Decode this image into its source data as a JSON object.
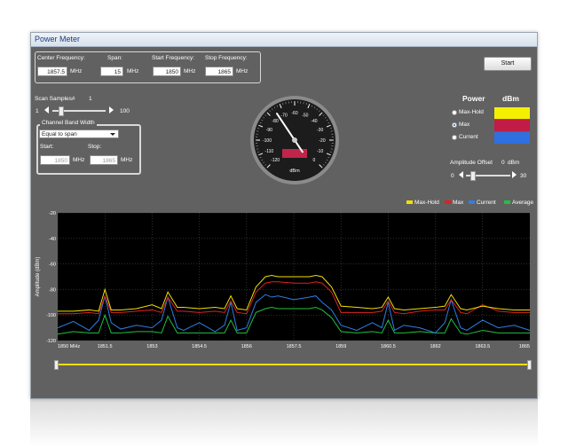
{
  "window": {
    "title": "Power Meter"
  },
  "frequency": {
    "center_label": "Center Frequency:",
    "center_value": "1857.5",
    "center_unit": "MHz",
    "span_label": "Span:",
    "span_value": "15",
    "span_unit": "MHz",
    "start_label": "Start Frequency:",
    "start_value": "1850",
    "start_unit": "MHz",
    "stop_label": "Stop Frequency:",
    "stop_value": "1865",
    "stop_unit": "MHz"
  },
  "start_button": "Start",
  "scan": {
    "label": "Scan Samples#",
    "value": "1",
    "min": "1",
    "max": "100",
    "position": 0.12
  },
  "channel_bw": {
    "title": "Channel Band Width",
    "mode": "Equal to span",
    "start_label": "Start:",
    "start_value": "1850",
    "start_unit": "MHz",
    "stop_label": "Stop:",
    "stop_value": "1865",
    "stop_unit": "MHz"
  },
  "gauge": {
    "ticks": [
      "-120",
      "-110",
      "-100",
      "-90",
      "-80",
      "-70",
      "-60",
      "-50",
      "-40",
      "-30",
      "-20",
      "-10",
      "0"
    ],
    "unit": "dBm",
    "needle_value": -75,
    "readout_color": "#c0254a"
  },
  "power_panel": {
    "power_label": "Power",
    "dbm_label": "dBm",
    "options": [
      {
        "label": "Max-Hold",
        "selected": false,
        "color": "#f5f000"
      },
      {
        "label": "Max",
        "selected": true,
        "color": "#c01c45"
      },
      {
        "label": "Current",
        "selected": false,
        "color": "#2f6fe0"
      }
    ]
  },
  "amp_offset": {
    "label": "Amplitude Offset",
    "value": "0",
    "unit": "dBm",
    "min": "0",
    "max": "30",
    "position": 0.1
  },
  "legend": [
    {
      "name": "Max-Hold",
      "color": "#f0e000"
    },
    {
      "name": "Max",
      "color": "#e02020"
    },
    {
      "name": "Current",
      "color": "#2f7ee8"
    },
    {
      "name": "Average",
      "color": "#22c040"
    }
  ],
  "range_slider": {
    "start": 0,
    "end": 1,
    "color": "#f0e000"
  },
  "chart_data": {
    "type": "line",
    "ylabel": "Amplitude (dBm)",
    "xlabel": "",
    "xlim": [
      1850,
      1865
    ],
    "ylim": [
      -120,
      -20
    ],
    "yticks": [
      "-20",
      "-40",
      "-60",
      "-80",
      "-100",
      "-120"
    ],
    "xticks": [
      "1850 MHz",
      "1851.5",
      "1853",
      "1854.5",
      "1856",
      "1857.5",
      "1859",
      "1860.5",
      "1862",
      "1863.5",
      "1865"
    ],
    "x": [
      1850,
      1850.5,
      1851,
      1851.3,
      1851.5,
      1851.7,
      1852,
      1852.5,
      1853,
      1853.3,
      1853.5,
      1853.8,
      1854,
      1854.5,
      1855,
      1855.3,
      1855.5,
      1855.7,
      1856,
      1856.3,
      1856.6,
      1856.8,
      1857,
      1857.5,
      1858,
      1858.2,
      1858.4,
      1858.7,
      1859,
      1859.5,
      1860,
      1860.3,
      1860.5,
      1860.7,
      1861,
      1861.5,
      1862,
      1862.3,
      1862.5,
      1862.8,
      1863,
      1863.5,
      1864,
      1864.5,
      1865
    ],
    "series": [
      {
        "name": "Max-Hold",
        "values": [
          -97,
          -97,
          -96,
          -97,
          -80,
          -96,
          -96,
          -95,
          -92,
          -95,
          -82,
          -94,
          -94,
          -95,
          -94,
          -95,
          -85,
          -95,
          -96,
          -78,
          -70,
          -69,
          -70,
          -70,
          -70,
          -69,
          -70,
          -78,
          -93,
          -94,
          -95,
          -94,
          -86,
          -95,
          -96,
          -95,
          -94,
          -93,
          -84,
          -95,
          -96,
          -93,
          -95,
          -96,
          -96
        ]
      },
      {
        "name": "Max",
        "values": [
          -99,
          -99,
          -98,
          -99,
          -85,
          -98,
          -98,
          -97,
          -96,
          -98,
          -86,
          -97,
          -97,
          -98,
          -97,
          -98,
          -89,
          -98,
          -99,
          -82,
          -75,
          -74,
          -74,
          -75,
          -75,
          -74,
          -75,
          -82,
          -98,
          -98,
          -98,
          -97,
          -89,
          -98,
          -99,
          -97,
          -96,
          -96,
          -88,
          -98,
          -99,
          -92,
          -97,
          -98,
          -98
        ]
      },
      {
        "name": "Current",
        "values": [
          -110,
          -105,
          -112,
          -104,
          -85,
          -106,
          -111,
          -108,
          -110,
          -104,
          -86,
          -110,
          -112,
          -106,
          -113,
          -108,
          -90,
          -112,
          -110,
          -90,
          -84,
          -86,
          -85,
          -88,
          -86,
          -85,
          -90,
          -96,
          -108,
          -112,
          -106,
          -110,
          -90,
          -112,
          -108,
          -110,
          -114,
          -106,
          -88,
          -110,
          -112,
          -104,
          -110,
          -108,
          -112
        ]
      },
      {
        "name": "Average",
        "values": [
          -115,
          -113,
          -114,
          -114,
          -100,
          -114,
          -114,
          -113,
          -113,
          -114,
          -101,
          -114,
          -114,
          -114,
          -114,
          -114,
          -104,
          -114,
          -114,
          -98,
          -95,
          -94,
          -95,
          -95,
          -95,
          -94,
          -96,
          -102,
          -113,
          -114,
          -113,
          -114,
          -104,
          -114,
          -114,
          -113,
          -114,
          -114,
          -103,
          -114,
          -115,
          -112,
          -114,
          -114,
          -114
        ]
      }
    ]
  }
}
